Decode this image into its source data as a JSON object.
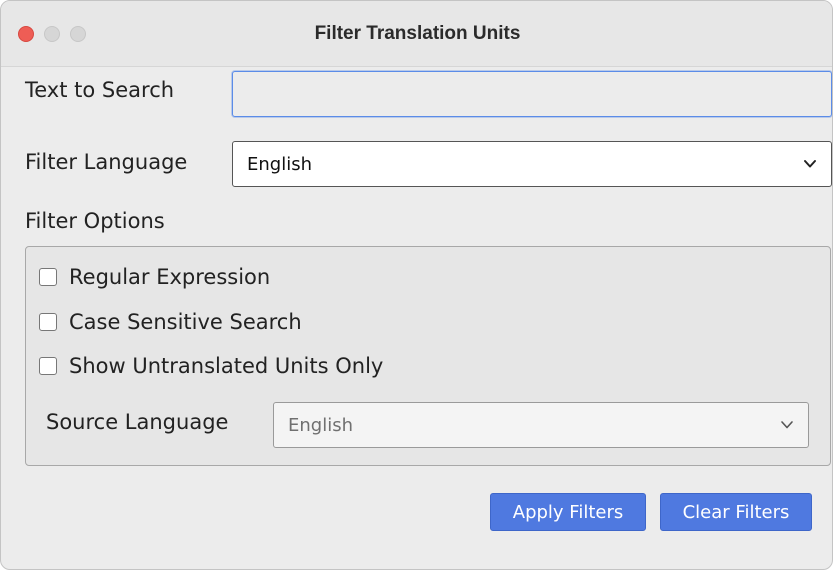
{
  "window": {
    "title": "Filter Translation Units"
  },
  "form": {
    "search_label": "Text to Search",
    "search_value": "",
    "language_label": "Filter Language",
    "language_value": "English",
    "options_label": "Filter Options"
  },
  "options": {
    "regex_label": "Regular Expression",
    "regex_checked": false,
    "case_label": "Case Sensitive Search",
    "case_checked": false,
    "untranslated_label": "Show Untranslated Units Only",
    "untranslated_checked": false,
    "source_language_label": "Source Language",
    "source_language_value": "English"
  },
  "buttons": {
    "apply": "Apply Filters",
    "clear": "Clear Filters"
  },
  "colors": {
    "accent": "#4f79e0",
    "close_button": "#ee5d55",
    "focus_ring": "#5b8ce8"
  },
  "icons": {
    "dropdown": "chevron-down-icon"
  }
}
